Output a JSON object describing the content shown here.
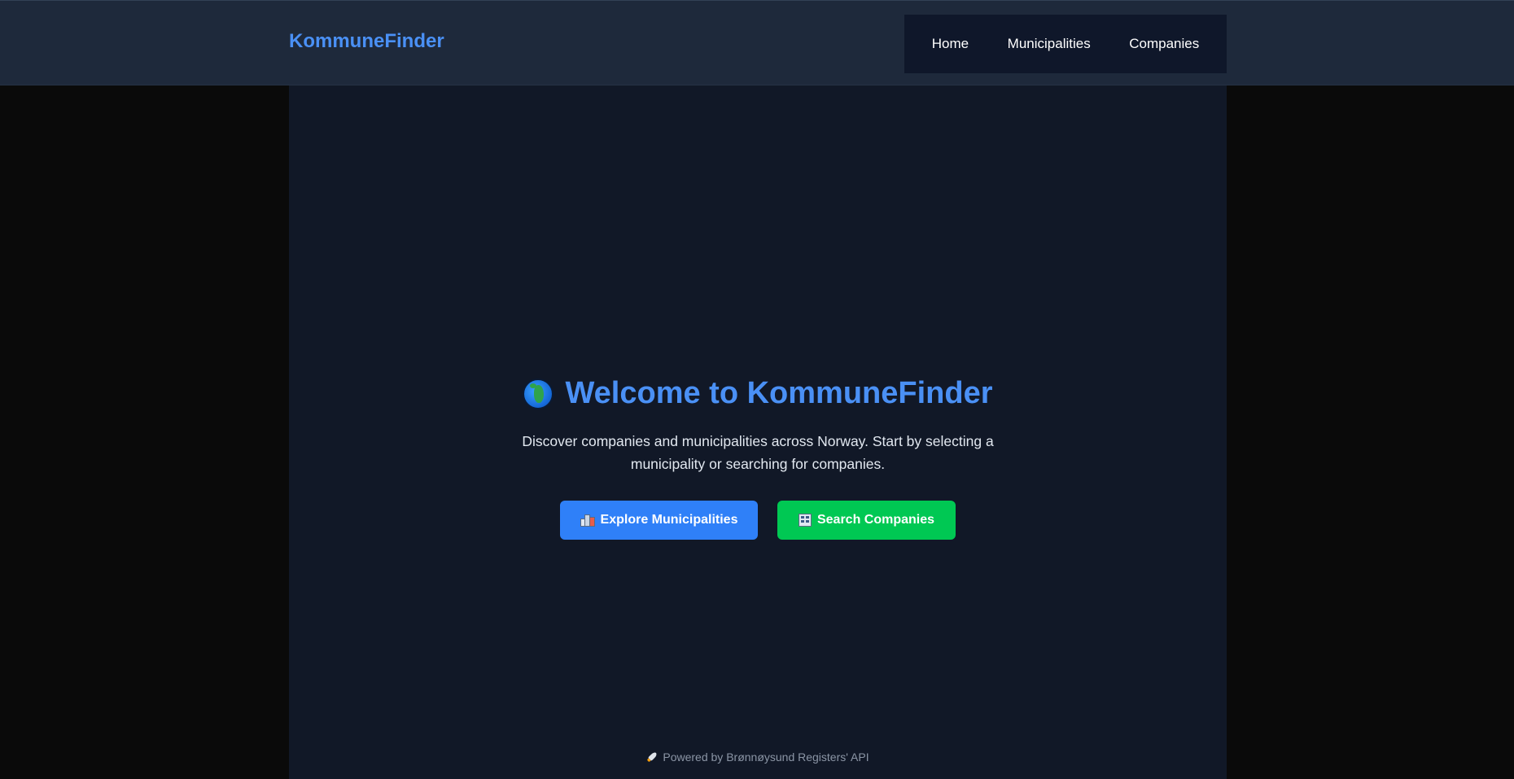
{
  "header": {
    "brand": "KommuneFinder",
    "nav": [
      {
        "label": "Home"
      },
      {
        "label": "Municipalities"
      },
      {
        "label": "Companies"
      }
    ]
  },
  "hero": {
    "icon": "globe-africa-icon",
    "title": "Welcome to KommuneFinder",
    "subtitle": "Discover companies and municipalities across Norway. Start by selecting a municipality or searching for companies.",
    "buttons": [
      {
        "label": "Explore Municipalities",
        "icon": "cityscape-icon",
        "color": "#2f80f8"
      },
      {
        "label": "Search Companies",
        "icon": "office-building-icon",
        "color": "#00c853"
      }
    ]
  },
  "footer": {
    "icon": "rocket-icon",
    "text": "Powered by Brønnøysund Registers' API"
  },
  "colors": {
    "accent": "#4a90f5",
    "topbar_bg": "#1e293b",
    "main_bg": "#111827",
    "page_bg": "#0a0a0a"
  }
}
